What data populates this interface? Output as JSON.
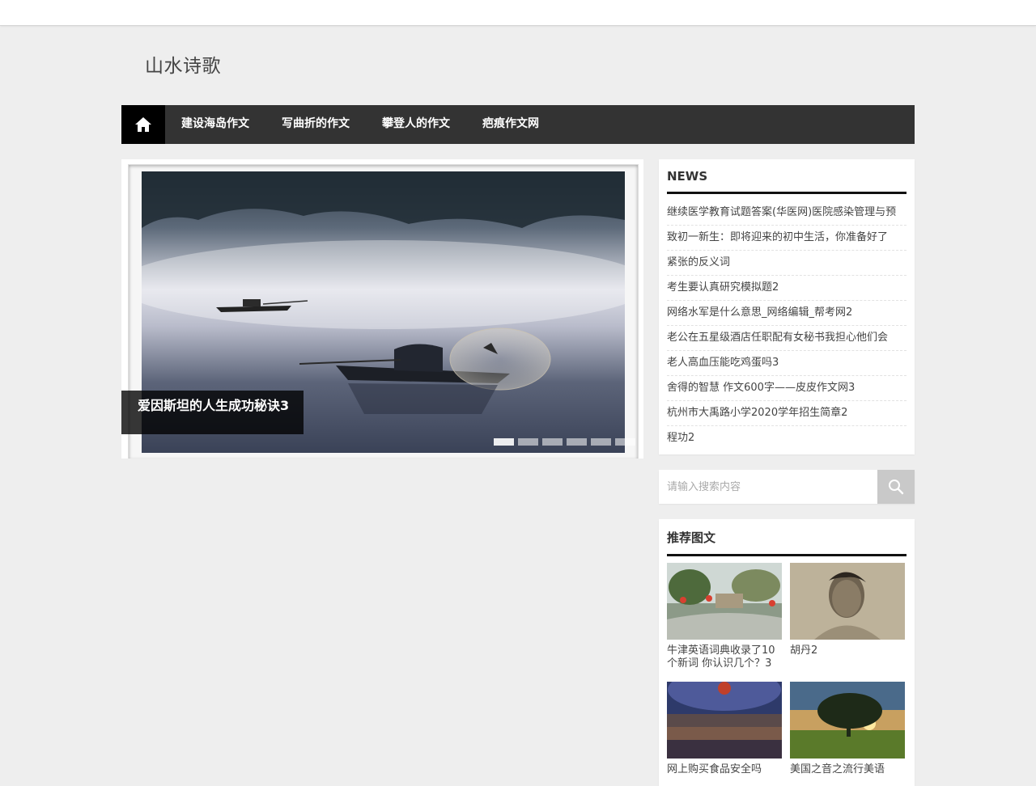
{
  "site": {
    "title": "山水诗歌"
  },
  "nav": {
    "home_icon": "home-icon",
    "items": [
      {
        "label": "建设海岛作文"
      },
      {
        "label": "写曲折的作文"
      },
      {
        "label": "攀登人的作文"
      },
      {
        "label": "疤痕作文网"
      }
    ]
  },
  "slider": {
    "caption": "爱因斯坦的人生成功秘诀3",
    "slide_count": 6,
    "active_index": 0
  },
  "news": {
    "title": "NEWS",
    "items": [
      "继续医学教育试题答案(华医网)医院感染管理与预",
      "致初一新生：即将迎来的初中生活，你准备好了",
      "紧张的反义词",
      "考生要认真研究模拟题2",
      "网络水军是什么意思_网络编辑_帮考网2",
      "老公在五星级酒店任职配有女秘书我担心他们会",
      "老人高血压能吃鸡蛋吗3",
      "舍得的智慧 作文600字——皮皮作文网3",
      "杭州市大禹路小学2020学年招生简章2",
      "程功2"
    ]
  },
  "search": {
    "placeholder": "请输入搜索内容",
    "value": "",
    "icon": "search-icon"
  },
  "recommend": {
    "title": "推荐图文",
    "items": [
      {
        "label": "牛津英语词典收录了10个新词 你认识几个？3"
      },
      {
        "label": "胡丹2"
      },
      {
        "label": "网上购买食品安全吗"
      },
      {
        "label": "美国之音之流行美语"
      }
    ]
  },
  "colors": {
    "nav_bg": "#333333",
    "nav_home_bg": "#000000",
    "page_bg": "#eeeeee",
    "search_button": "#c9c9c9"
  }
}
